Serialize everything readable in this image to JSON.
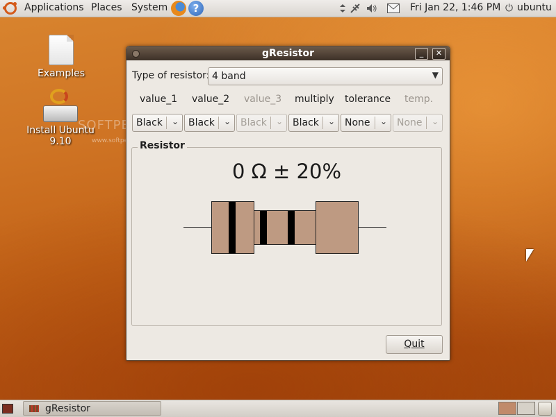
{
  "top_panel": {
    "menus": [
      "Applications",
      "Places",
      "System"
    ],
    "datetime": "Fri Jan 22,  1:46 PM",
    "user": "ubuntu",
    "power_glyph": "⏻",
    "help_glyph": "?",
    "icons": [
      "ubuntu-logo",
      "firefox-icon",
      "help-icon",
      "network-icon",
      "volume-icon",
      "mail-icon",
      "power-icon"
    ]
  },
  "desktop": {
    "icons": [
      {
        "label": "Examples",
        "icon": "document-icon"
      },
      {
        "label": "Install Ubuntu 9.10",
        "icon": "installer-icon"
      }
    ],
    "watermark": "SOFTPEDIA",
    "watermark_url": "www.softpedia.com"
  },
  "window": {
    "title": "gResistor",
    "minimize_glyph": "_",
    "close_glyph": "✕",
    "type_label": "Type of resistor:",
    "type_value": "4 band",
    "columns": [
      {
        "label": "value_1",
        "value": "Black",
        "enabled": true
      },
      {
        "label": "value_2",
        "value": "Black",
        "enabled": true
      },
      {
        "label": "value_3",
        "value": "Black",
        "enabled": false
      },
      {
        "label": "multiply",
        "value": "Black",
        "enabled": true
      },
      {
        "label": "tolerance",
        "value": "None",
        "enabled": true
      },
      {
        "label": "temp.",
        "value": "None",
        "enabled": false
      }
    ],
    "frame_title": "Resistor",
    "result": "0 Ω ± 20%",
    "resistor": {
      "body_color": "#be9a82",
      "band_colors": [
        "#000000",
        "#000000",
        "#000000"
      ]
    },
    "quit_label": "Quit"
  },
  "bottom_panel": {
    "task_label": "gResistor",
    "workspace_colors": [
      "#c08a6a",
      "#d6d1c8"
    ]
  },
  "colors": {
    "accent": "#d45a1a",
    "titlebar": "#4a3c30",
    "window_bg": "#ede9e3"
  }
}
